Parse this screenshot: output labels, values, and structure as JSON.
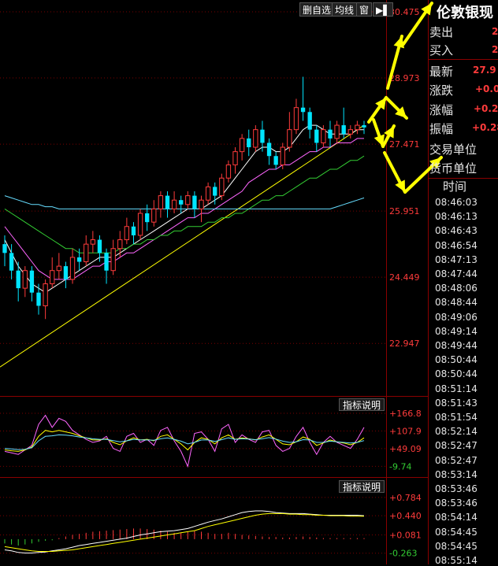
{
  "toolbar": {
    "delete_watch_label": "删自选",
    "ma_label": "均线",
    "window_label": "窗",
    "nav_label": "▶▌"
  },
  "right_panel": {
    "title": "伦敦银现",
    "sell_label": "卖出",
    "sell_value": "2",
    "buy_label": "买入",
    "buy_value": "2",
    "latest_label": "最新",
    "latest_value": "27.9",
    "change_label": "涨跌",
    "change_value": "+0.0",
    "change_pct_label": "涨幅",
    "change_pct_value": "+0.2",
    "amplitude_label": "振幅",
    "amplitude_value": "+0.28",
    "trade_unit_label": "交易单位",
    "currency_unit_label": "货币单位",
    "time_header": "时间",
    "times": [
      "08:46:03",
      "08:46:13",
      "08:46:43",
      "08:46:54",
      "08:47:13",
      "08:47:44",
      "08:48:06",
      "08:48:44",
      "08:49:06",
      "08:49:14",
      "08:49:44",
      "08:50:44",
      "08:50:44",
      "08:51:14",
      "08:51:43",
      "08:51:54",
      "08:52:14",
      "08:52:47",
      "08:52:47",
      "08:53:14",
      "08:53:46",
      "08:53:46",
      "08:54:14",
      "08:54:45",
      "08:54:45",
      "08:55:14"
    ]
  },
  "panels": {
    "indicator_button_label": "指标说明"
  },
  "colors": {
    "up": "#ff3b3b",
    "down": "#00e5ff",
    "ma_white": "#ffffff",
    "ma_yellow": "#ffff00",
    "ma_magenta": "#ff66ff",
    "ma_green": "#33cc33",
    "ma_cyan": "#66ddff",
    "axis_red": "#ff3b3b",
    "axis_green": "#33cc33",
    "arrow": "#ffff00"
  },
  "chart_data": [
    {
      "type": "candlestick",
      "y_ticks": [
        "30.475",
        "28.973",
        "27.471",
        "25.951",
        "24.449",
        "22.947"
      ],
      "ylim": [
        22.2,
        30.6
      ],
      "candles": [
        [
          25.2,
          25.0,
          25.4,
          24.7
        ],
        [
          25.0,
          24.6,
          25.2,
          24.4
        ],
        [
          24.6,
          24.2,
          24.8,
          23.9
        ],
        [
          24.2,
          24.6,
          24.7,
          24.0
        ],
        [
          24.6,
          24.1,
          24.7,
          23.9
        ],
        [
          24.1,
          23.8,
          24.3,
          23.6
        ],
        [
          23.8,
          24.3,
          24.4,
          23.5
        ],
        [
          24.3,
          24.6,
          24.9,
          24.2
        ],
        [
          24.6,
          24.7,
          25.0,
          24.4
        ],
        [
          24.7,
          24.4,
          24.8,
          24.2
        ],
        [
          24.4,
          24.9,
          25.1,
          24.3
        ],
        [
          24.9,
          24.8,
          25.1,
          24.6
        ],
        [
          24.8,
          25.2,
          25.4,
          24.7
        ],
        [
          25.2,
          25.3,
          25.5,
          25.0
        ],
        [
          25.3,
          25.0,
          25.4,
          24.8
        ],
        [
          25.0,
          24.6,
          25.1,
          24.3
        ],
        [
          24.6,
          25.1,
          25.3,
          24.5
        ],
        [
          25.1,
          25.3,
          25.5,
          24.9
        ],
        [
          25.3,
          25.6,
          25.8,
          25.2
        ],
        [
          25.6,
          25.4,
          25.7,
          25.2
        ],
        [
          25.4,
          25.9,
          26.0,
          25.3
        ],
        [
          25.9,
          25.7,
          26.1,
          25.5
        ],
        [
          25.7,
          26.0,
          26.2,
          25.6
        ],
        [
          26.0,
          26.3,
          26.4,
          25.8
        ],
        [
          26.3,
          26.0,
          26.4,
          25.8
        ],
        [
          26.0,
          26.2,
          26.4,
          25.9
        ],
        [
          26.2,
          26.1,
          26.3,
          25.9
        ],
        [
          26.1,
          26.3,
          26.4,
          26.0
        ],
        [
          26.3,
          26.0,
          26.4,
          25.8
        ],
        [
          26.0,
          26.2,
          26.3,
          25.7
        ],
        [
          26.2,
          26.5,
          26.6,
          26.1
        ],
        [
          26.5,
          26.3,
          26.6,
          26.1
        ],
        [
          26.3,
          26.7,
          26.8,
          26.2
        ],
        [
          26.7,
          27.0,
          27.1,
          26.6
        ],
        [
          27.0,
          27.3,
          27.4,
          26.8
        ],
        [
          27.3,
          27.6,
          27.7,
          27.1
        ],
        [
          27.6,
          27.4,
          27.8,
          27.2
        ],
        [
          27.4,
          27.8,
          27.9,
          27.3
        ],
        [
          27.8,
          27.5,
          28.0,
          27.3
        ],
        [
          27.5,
          27.2,
          27.6,
          27.0
        ],
        [
          27.2,
          27.0,
          27.3,
          26.9
        ],
        [
          27.0,
          27.4,
          27.5,
          26.9
        ],
        [
          27.4,
          27.8,
          28.2,
          27.3
        ],
        [
          27.8,
          28.3,
          28.5,
          27.7
        ],
        [
          28.3,
          28.2,
          29.0,
          28.0
        ],
        [
          28.2,
          27.8,
          28.3,
          27.6
        ],
        [
          27.8,
          27.5,
          27.9,
          27.3
        ],
        [
          27.5,
          27.8,
          27.9,
          27.4
        ],
        [
          27.8,
          27.6,
          28.0,
          27.4
        ],
        [
          27.6,
          27.9,
          28.0,
          27.5
        ],
        [
          27.9,
          27.7,
          28.3,
          27.6
        ],
        [
          27.7,
          27.8,
          27.9,
          27.6
        ],
        [
          27.8,
          27.9,
          28.0,
          27.7
        ],
        [
          27.9,
          27.85,
          28.0,
          27.7
        ]
      ],
      "ma_lines": [
        {
          "name": "MA_white",
          "color_key": "ma_white",
          "values": [
            25.3,
            25.0,
            24.7,
            24.5,
            24.3,
            24.2,
            24.1,
            24.2,
            24.3,
            24.4,
            24.5,
            24.6,
            24.7,
            24.8,
            24.9,
            24.9,
            24.9,
            25.0,
            25.1,
            25.2,
            25.3,
            25.4,
            25.5,
            25.6,
            25.7,
            25.8,
            25.9,
            26.0,
            26.0,
            26.0,
            26.1,
            26.2,
            26.3,
            26.5,
            26.7,
            26.9,
            27.1,
            27.3,
            27.4,
            27.4,
            27.3,
            27.3,
            27.4,
            27.6,
            27.8,
            27.9,
            27.9,
            27.8,
            27.7,
            27.7,
            27.7,
            27.7,
            27.8,
            27.8
          ]
        },
        {
          "name": "MA_magenta",
          "color_key": "ma_magenta",
          "values": [
            25.6,
            25.4,
            25.2,
            25.0,
            24.8,
            24.6,
            24.5,
            24.4,
            24.4,
            24.4,
            24.4,
            24.5,
            24.6,
            24.7,
            24.7,
            24.8,
            24.8,
            24.9,
            25.0,
            25.0,
            25.1,
            25.2,
            25.3,
            25.4,
            25.5,
            25.6,
            25.7,
            25.8,
            25.8,
            25.9,
            25.9,
            26.0,
            26.1,
            26.2,
            26.3,
            26.4,
            26.6,
            26.7,
            26.8,
            26.9,
            26.9,
            27.0,
            27.0,
            27.1,
            27.2,
            27.3,
            27.3,
            27.4,
            27.4,
            27.5,
            27.5,
            27.5,
            27.6,
            27.6
          ]
        },
        {
          "name": "MA_green",
          "color_key": "ma_green",
          "values": [
            26.0,
            25.9,
            25.8,
            25.7,
            25.6,
            25.5,
            25.4,
            25.3,
            25.2,
            25.1,
            25.1,
            25.0,
            25.0,
            25.0,
            25.0,
            25.0,
            25.0,
            25.1,
            25.1,
            25.2,
            25.2,
            25.3,
            25.3,
            25.4,
            25.4,
            25.5,
            25.5,
            25.6,
            25.6,
            25.6,
            25.7,
            25.7,
            25.8,
            25.8,
            25.9,
            25.9,
            26.0,
            26.1,
            26.2,
            26.2,
            26.3,
            26.3,
            26.4,
            26.5,
            26.6,
            26.7,
            26.7,
            26.8,
            26.9,
            26.9,
            27.0,
            27.1,
            27.1,
            27.2
          ]
        },
        {
          "name": "MA_cyan",
          "color_key": "ma_cyan",
          "values": [
            26.3,
            26.25,
            26.2,
            26.15,
            26.1,
            26.1,
            26.05,
            26.05,
            26.0,
            26.0,
            26.0,
            26.0,
            26.0,
            26.0,
            26.0,
            26.0,
            26.0,
            26.0,
            26.0,
            26.0,
            26.0,
            26.0,
            26.0,
            26.0,
            26.0,
            26.0,
            26.0,
            26.0,
            26.0,
            26.0,
            26.0,
            26.0,
            26.0,
            26.0,
            26.0,
            26.0,
            26.0,
            26.0,
            26.0,
            26.0,
            26.0,
            26.0,
            26.0,
            26.0,
            26.0,
            26.0,
            26.0,
            26.0,
            26.0,
            26.05,
            26.1,
            26.15,
            26.2,
            26.25
          ]
        }
      ],
      "trendline": [
        [
          0,
          22.5
        ],
        [
          53,
          27.9
        ]
      ]
    },
    {
      "type": "line",
      "y_ticks": [
        {
          "label": "+166.8",
          "value": 166.8,
          "color_key": "axis_red"
        },
        {
          "label": "+107.9",
          "value": 107.9,
          "color_key": "axis_red"
        },
        {
          "label": "+49.09",
          "value": 49.09,
          "color_key": "axis_red"
        },
        {
          "label": "-9.74",
          "value": -9.74,
          "color_key": "axis_green"
        }
      ],
      "ylim": [
        -35,
        180
      ],
      "series": [
        {
          "color_key": "ma_magenta",
          "values": [
            40,
            35,
            30,
            45,
            60,
            130,
            160,
            120,
            150,
            140,
            110,
            95,
            80,
            70,
            75,
            90,
            50,
            40,
            90,
            100,
            70,
            80,
            60,
            110,
            120,
            75,
            40,
            -10,
            100,
            105,
            80,
            40,
            115,
            130,
            70,
            95,
            80,
            70,
            105,
            110,
            60,
            40,
            50,
            90,
            120,
            70,
            30,
            70,
            90,
            70,
            60,
            50,
            80,
            120
          ]
        },
        {
          "color_key": "ma_yellow",
          "values": [
            45,
            42,
            40,
            45,
            55,
            90,
            110,
            105,
            110,
            105,
            100,
            92,
            85,
            78,
            78,
            82,
            70,
            62,
            75,
            85,
            78,
            80,
            75,
            90,
            95,
            80,
            65,
            45,
            70,
            85,
            80,
            65,
            85,
            95,
            80,
            85,
            82,
            78,
            88,
            95,
            80,
            65,
            62,
            72,
            88,
            80,
            60,
            68,
            78,
            72,
            68,
            62,
            70,
            85
          ]
        },
        {
          "color_key": "ma_cyan",
          "values": [
            50,
            48,
            46,
            47,
            52,
            75,
            90,
            92,
            95,
            94,
            92,
            88,
            85,
            82,
            80,
            80,
            76,
            72,
            75,
            80,
            78,
            78,
            77,
            82,
            85,
            80,
            74,
            65,
            70,
            78,
            78,
            73,
            79,
            85,
            80,
            82,
            81,
            79,
            82,
            86,
            81,
            74,
            70,
            72,
            79,
            78,
            70,
            70,
            74,
            72,
            70,
            68,
            70,
            76
          ]
        }
      ]
    },
    {
      "type": "bar",
      "y_ticks": [
        {
          "label": "+0.784",
          "value": 0.784,
          "color_key": "axis_red"
        },
        {
          "label": "+0.440",
          "value": 0.44,
          "color_key": "axis_red"
        },
        {
          "label": "+0.081",
          "value": 0.081,
          "color_key": "axis_red"
        },
        {
          "label": "-0.263",
          "value": -0.263,
          "color_key": "axis_green"
        }
      ],
      "ylim": [
        -0.4,
        0.9
      ],
      "histogram": [
        -0.08,
        -0.1,
        -0.12,
        -0.1,
        -0.08,
        -0.05,
        -0.03,
        -0.02,
        0.02,
        0.05,
        0.08,
        0.1,
        0.12,
        0.14,
        0.15,
        0.16,
        0.17,
        0.18,
        0.19,
        0.2,
        0.2,
        0.19,
        0.18,
        0.16,
        0.14,
        0.12,
        0.12,
        0.14,
        0.16,
        0.14,
        0.12,
        0.1,
        0.1,
        0.12,
        0.1,
        0.08,
        0.07,
        0.06,
        0.05,
        0.04,
        0.04,
        0.03,
        0.03,
        0.04,
        0.05,
        0.04,
        0.03,
        0.02,
        0.02,
        0.02,
        0.02,
        0.02,
        0.02,
        0.02
      ],
      "series": [
        {
          "color_key": "ma_white",
          "values": [
            -0.2,
            -0.22,
            -0.25,
            -0.26,
            -0.26,
            -0.25,
            -0.24,
            -0.22,
            -0.2,
            -0.18,
            -0.15,
            -0.12,
            -0.1,
            -0.08,
            -0.06,
            -0.04,
            -0.02,
            0.0,
            0.02,
            0.05,
            0.08,
            0.1,
            0.12,
            0.14,
            0.15,
            0.16,
            0.18,
            0.2,
            0.24,
            0.28,
            0.32,
            0.35,
            0.38,
            0.42,
            0.46,
            0.5,
            0.52,
            0.53,
            0.53,
            0.52,
            0.5,
            0.49,
            0.48,
            0.48,
            0.48,
            0.47,
            0.46,
            0.45,
            0.45,
            0.45,
            0.45,
            0.45,
            0.45,
            0.44
          ]
        },
        {
          "color_key": "ma_yellow",
          "values": [
            -0.14,
            -0.16,
            -0.18,
            -0.2,
            -0.22,
            -0.23,
            -0.23,
            -0.23,
            -0.22,
            -0.21,
            -0.2,
            -0.18,
            -0.16,
            -0.14,
            -0.12,
            -0.1,
            -0.08,
            -0.06,
            -0.04,
            -0.02,
            0.0,
            0.02,
            0.04,
            0.06,
            0.08,
            0.1,
            0.12,
            0.14,
            0.16,
            0.2,
            0.24,
            0.27,
            0.3,
            0.33,
            0.36,
            0.39,
            0.42,
            0.45,
            0.47,
            0.48,
            0.48,
            0.48,
            0.47,
            0.47,
            0.46,
            0.46,
            0.45,
            0.45,
            0.44,
            0.44,
            0.44,
            0.43,
            0.43,
            0.43
          ]
        }
      ]
    }
  ]
}
